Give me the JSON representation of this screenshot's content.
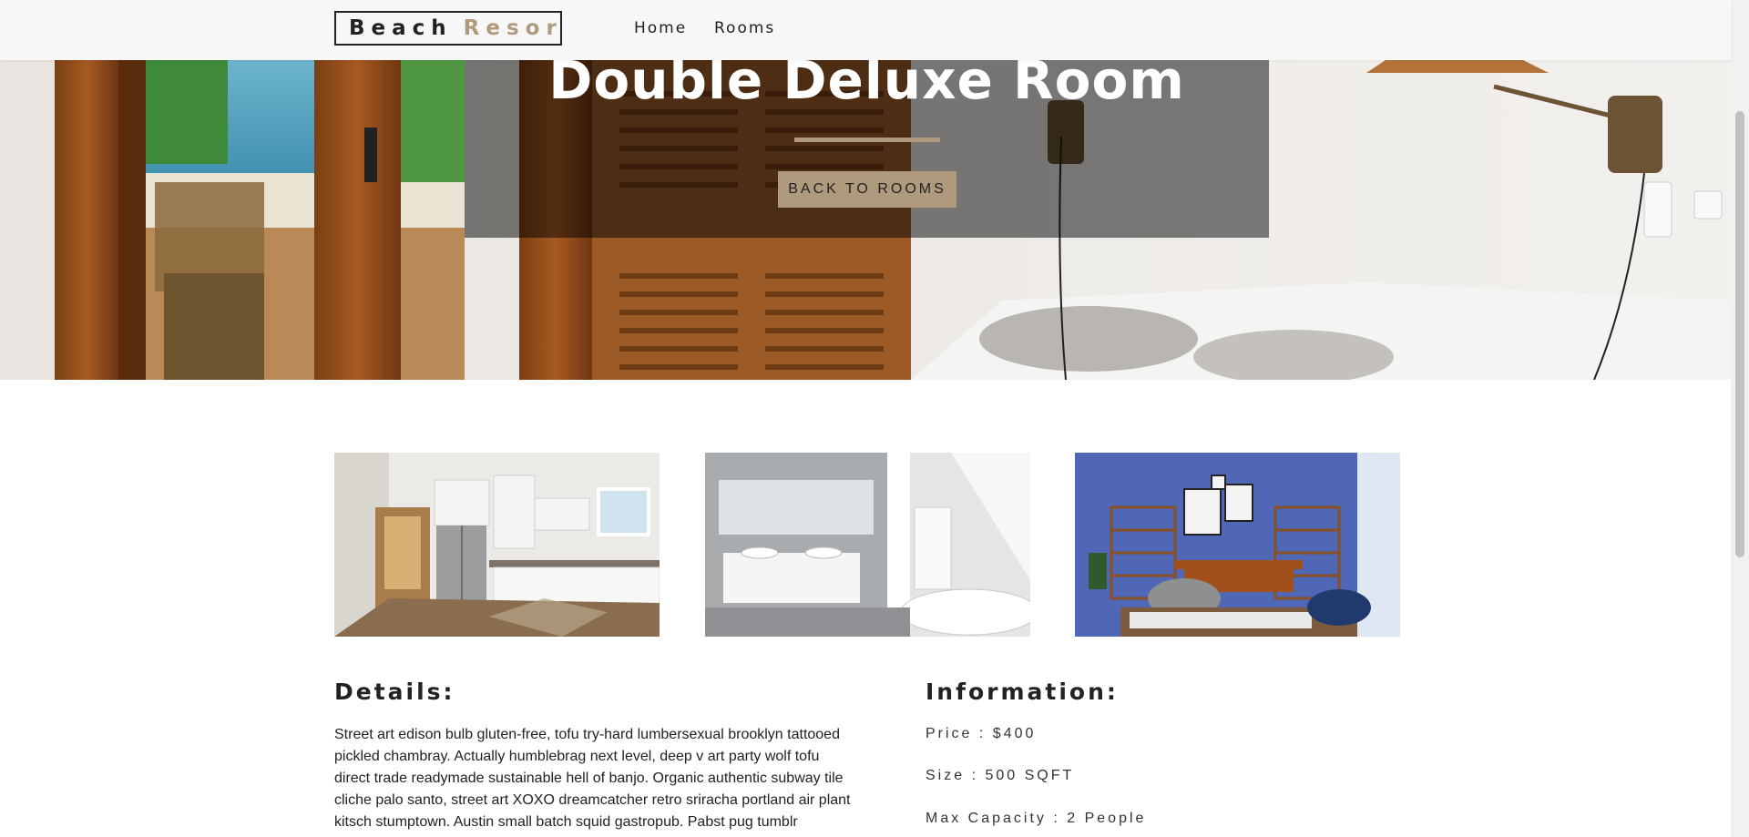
{
  "navbar": {
    "logo_word1": "Beach",
    "logo_word2": "Resort",
    "links": [
      "Home",
      "Rooms"
    ]
  },
  "hero": {
    "title": "Double Deluxe Room",
    "button_label": "BACK TO ROOMS"
  },
  "gallery": {
    "images": [
      "kitchen-photo",
      "bathroom-photo",
      "living-room-photo"
    ]
  },
  "details": {
    "heading": "Details:",
    "description": "Street art edison bulb gluten-free, tofu try-hard lumbersexual brooklyn tattooed pickled chambray. Actually humblebrag next level, deep v art party wolf tofu direct trade readymade sustainable hell of banjo. Organic authentic subway tile cliche palo santo, street art XOXO dreamcatcher retro sriracha portland air plant kitsch stumptown. Austin small batch squid gastropub. Pabst pug tumblr"
  },
  "information": {
    "heading": "Information:",
    "price": "Price : $400",
    "size": "Size : 500 SQFT",
    "capacity": "Max Capacity : 2 People"
  },
  "colors": {
    "accent": "#af9a7d",
    "dark": "#222222",
    "nav_bg": "#f7f7f7"
  }
}
